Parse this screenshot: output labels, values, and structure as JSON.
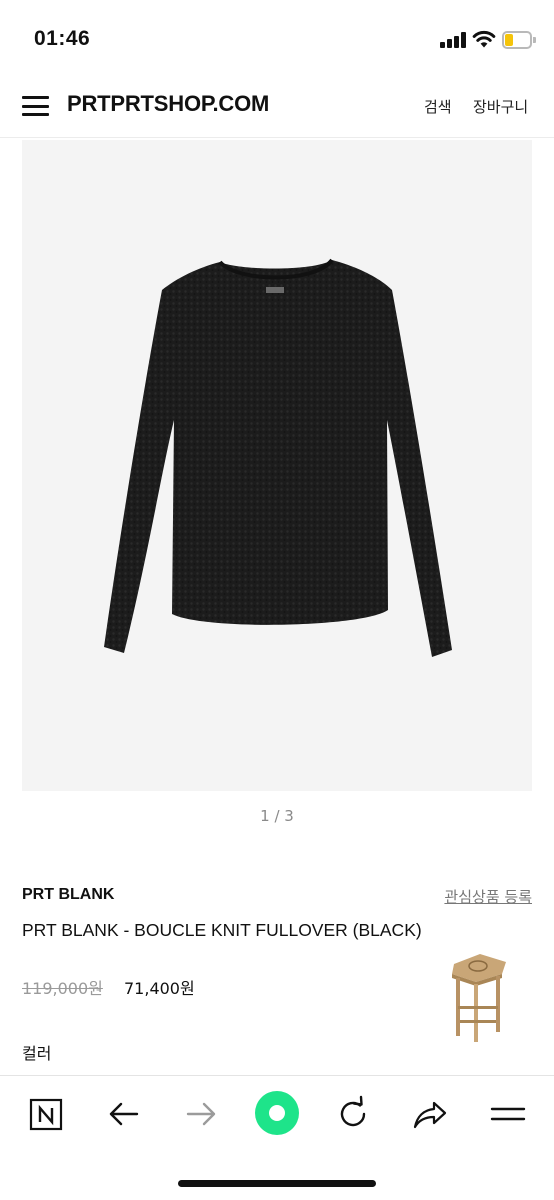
{
  "status_bar": {
    "time": "01:46",
    "battery_level": 0.2,
    "battery_color": "#f5c40a"
  },
  "header": {
    "logo": "PRTPRTSHOP.COM",
    "search_label": "검색",
    "cart_label": "장바구니",
    "menu_icon": "hamburger-menu-icon"
  },
  "gallery": {
    "counter": "1 / 3",
    "current_page": 1,
    "total_pages": 3,
    "background": "#f4f4f4"
  },
  "product": {
    "brand": "PRT BLANK",
    "wishlist_label": "관심상품 등록",
    "title": "PRT BLANK - BOUCLE KNIT FULLOVER (BLACK)",
    "original_price": "119,000원",
    "sale_price": "71,400원",
    "option_label": "컬러"
  },
  "browser_toolbar": {
    "items": [
      {
        "icon": "naver-n-icon"
      },
      {
        "icon": "back-arrow-icon"
      },
      {
        "icon": "forward-arrow-icon"
      },
      {
        "icon": "green-circle-icon"
      },
      {
        "icon": "reload-icon"
      },
      {
        "icon": "share-icon"
      },
      {
        "icon": "menu-lines-icon"
      }
    ],
    "accent_color": "#1ee48a"
  }
}
